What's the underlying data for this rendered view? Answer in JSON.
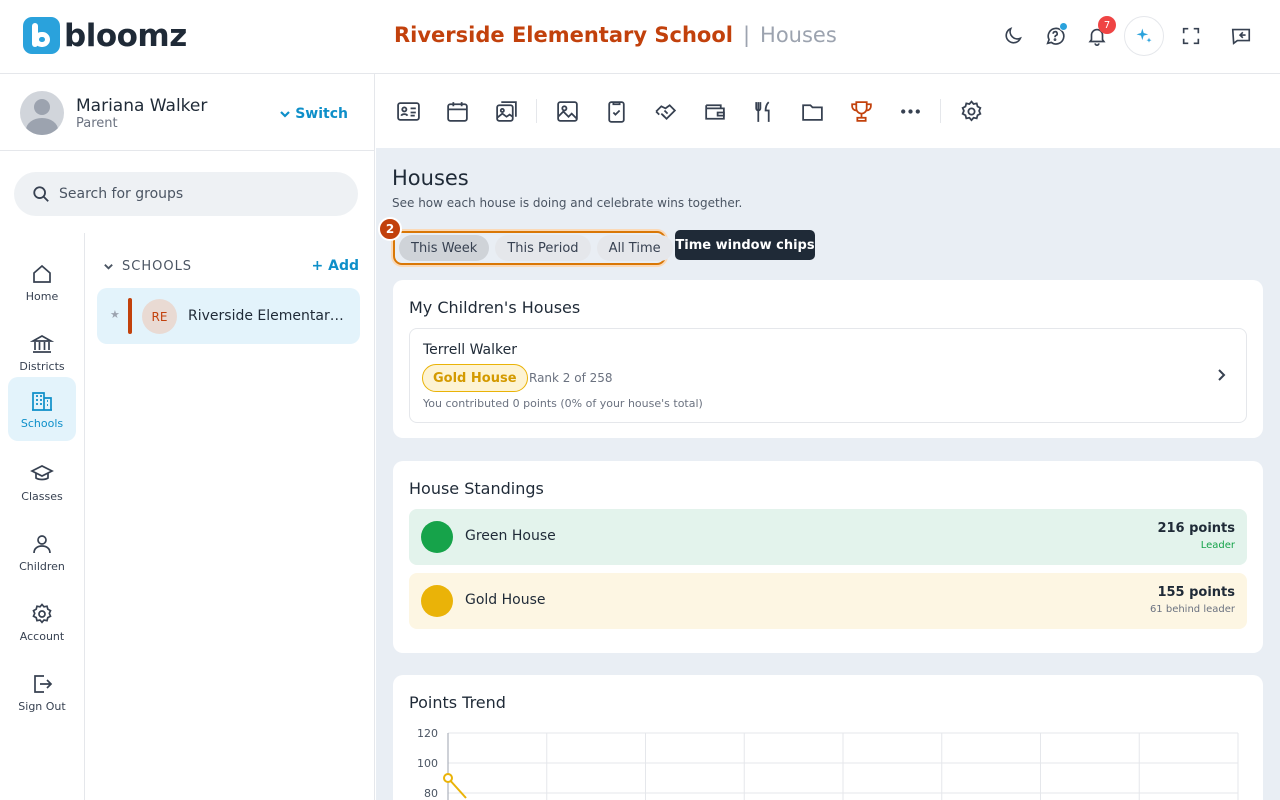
{
  "header": {
    "logo_text": "bloomz",
    "school_name": "Riverside Elementary School",
    "separator": "|",
    "page_name": "Houses",
    "notification_count": "7",
    "icons": [
      "moon-icon",
      "help-icon",
      "bell-icon",
      "sparkle-icon",
      "fullscreen-icon",
      "message-icon"
    ]
  },
  "profile": {
    "name": "Mariana Walker",
    "role": "Parent",
    "switch_label": "Switch"
  },
  "search": {
    "placeholder": "Search for groups"
  },
  "nav": {
    "items": [
      {
        "label": "Home",
        "icon": "home-icon"
      },
      {
        "label": "Districts",
        "icon": "bank-icon"
      },
      {
        "label": "Schools",
        "icon": "building-icon",
        "active": true
      },
      {
        "label": "Classes",
        "icon": "cap-icon"
      },
      {
        "label": "Children",
        "icon": "person-icon"
      },
      {
        "label": "Account",
        "icon": "gear-icon"
      },
      {
        "label": "Sign Out",
        "icon": "signout-icon"
      }
    ]
  },
  "groups": {
    "header": "SCHOOLS",
    "add_label": "Add",
    "add_symbol": "+",
    "items": [
      {
        "initials": "RE",
        "name": "Riverside Elementary School",
        "star": "★"
      }
    ]
  },
  "toolbar": {
    "icons": [
      "newsletter-icon",
      "calendar-icon",
      "photo-album-icon",
      "image-icon",
      "checklist-icon",
      "handshake-icon",
      "wallet-icon",
      "dining-icon",
      "folder-icon",
      "trophy-icon",
      "more-icon",
      "settings-icon"
    ],
    "active": "trophy-icon"
  },
  "page": {
    "title": "Houses",
    "subtitle": "See how each house is doing and celebrate wins together."
  },
  "time_chips": {
    "badge": "2",
    "items": [
      "This Week",
      "This Period",
      "All Time"
    ],
    "selected": "This Week",
    "tooltip": "Time window chips"
  },
  "my_children": {
    "title": "My Children's Houses",
    "child": {
      "name": "Terrell Walker",
      "house": "Gold House",
      "rank": "Rank 2 of 258",
      "contribution": "You contributed 0 points (0% of your house's total)"
    }
  },
  "standings": {
    "title": "House Standings",
    "rows": [
      {
        "name": "Green House",
        "points": "216 points",
        "note": "Leader",
        "color": "#16a34a",
        "bg": "#e3f3ec",
        "note_color": "#16a34a"
      },
      {
        "name": "Gold House",
        "points": "155 points",
        "note": "61 behind leader",
        "color": "#eab308",
        "bg": "#fdf6e3",
        "note_color": "#6b7280"
      }
    ]
  },
  "trend": {
    "title": "Points Trend"
  },
  "chart_data": {
    "type": "line",
    "yticks": [
      120,
      100,
      80
    ],
    "ylim": [
      80,
      120
    ],
    "series": [
      {
        "color": "#eab308",
        "points": [
          {
            "x": 0,
            "y": 90
          }
        ]
      }
    ]
  }
}
